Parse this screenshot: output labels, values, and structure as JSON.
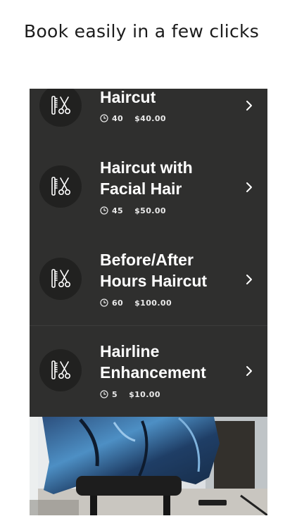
{
  "headline": "Book easily in a few clicks",
  "services": [
    {
      "title": "Haircut",
      "duration": "40",
      "price": "$40.00"
    },
    {
      "title": "Haircut with Facial Hair",
      "duration": "45",
      "price": "$50.00"
    },
    {
      "title": "Before/After Hours Haircut",
      "duration": "60",
      "price": "$100.00"
    },
    {
      "title": "Hairline Enhancement",
      "duration": "5",
      "price": "$10.00"
    }
  ],
  "icons": {
    "service": "barber-tools-icon",
    "duration": "clock-icon",
    "open": "chevron-right-icon"
  },
  "colors": {
    "panel": "#2f2f2e",
    "badge": "#212120",
    "text": "#ffffff"
  }
}
